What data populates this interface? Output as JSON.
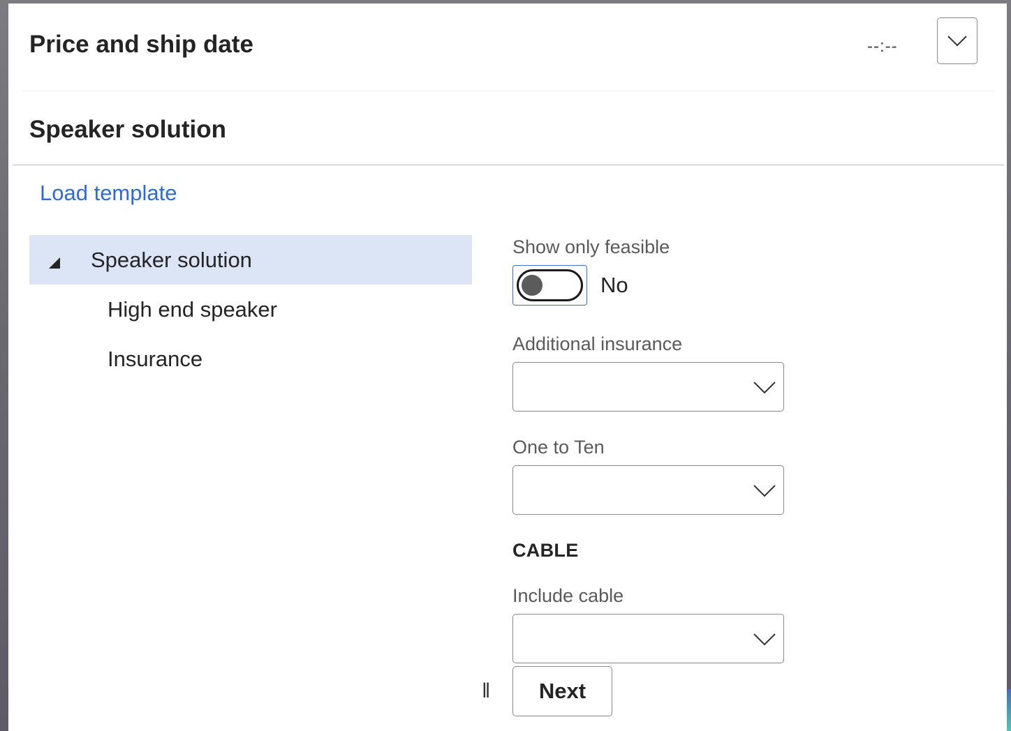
{
  "price_section": {
    "title": "Price and ship date",
    "value": "--:--",
    "collapse_icon": "chevron-down-icon"
  },
  "speaker_section": {
    "title": "Speaker solution",
    "load_template": "Load template"
  },
  "tree": {
    "root": {
      "label": "Speaker solution",
      "expanded": true,
      "selected": true,
      "toggle_icon": "collapse-triangle-icon"
    },
    "children": [
      {
        "label": "High end speaker"
      },
      {
        "label": "Insurance"
      }
    ]
  },
  "form": {
    "show_only_feasible": {
      "label": "Show only feasible",
      "state_text": "No",
      "checked": false
    },
    "additional_insurance": {
      "label": "Additional insurance",
      "value": ""
    },
    "one_to_ten": {
      "label": "One to Ten",
      "value": ""
    },
    "cable_group": {
      "heading": "CABLE"
    },
    "include_cable": {
      "label": "Include cable",
      "value": ""
    },
    "grip_glyph": "‖",
    "next_label": "Next"
  },
  "colors": {
    "accent": "#2f6bd6",
    "selected_row": "#dce5f6",
    "focus_outline": "#3b6fd8",
    "text": "#242424"
  }
}
